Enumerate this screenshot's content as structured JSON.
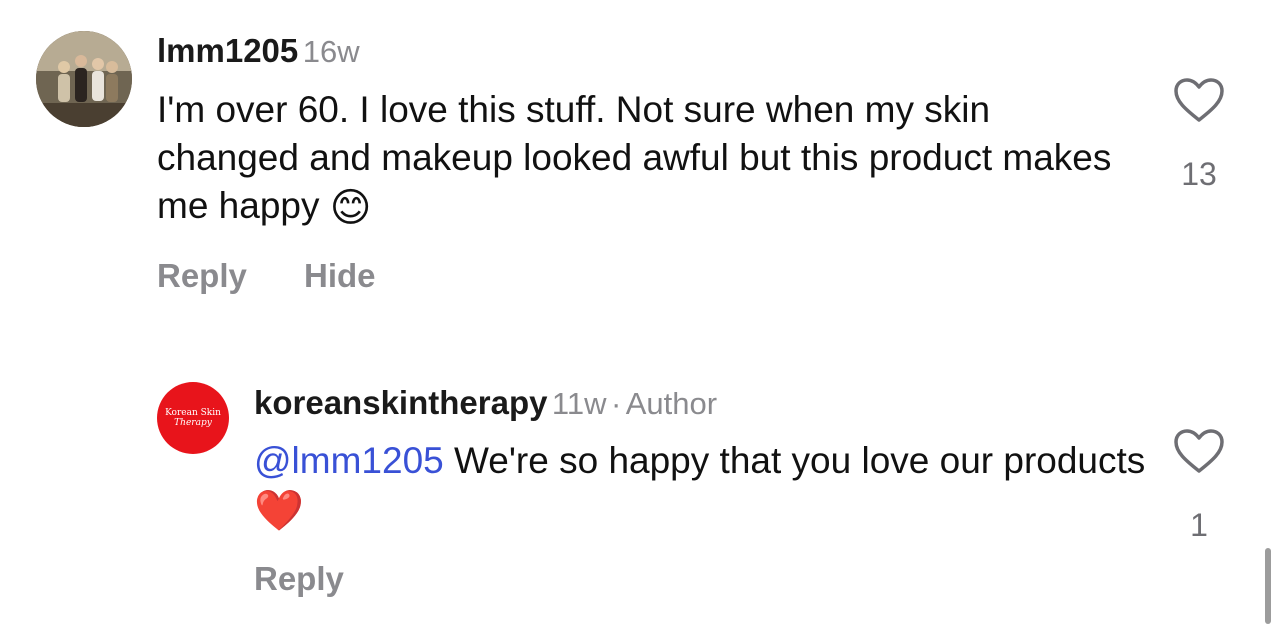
{
  "comments": [
    {
      "username": "lmm1205",
      "age": "16w",
      "text": "I'm over 60.  I love this stuff.  Not sure when my skin changed and makeup looked awful but this product makes me happy",
      "emoji": "😊",
      "like_count": "13",
      "actions": {
        "reply": "Reply",
        "hide": "Hide"
      },
      "avatar_icon": "profile-photo"
    }
  ],
  "reply": {
    "username": "koreanskintherapy",
    "age": "11w",
    "separator": "·",
    "badge": "Author",
    "mention": "@lmm1205",
    "text": "We're so happy that you love our products",
    "emoji": "❤️",
    "like_count": "1",
    "actions": {
      "reply": "Reply"
    },
    "avatar": {
      "line1": "Korean Skin",
      "line2": "Therapy",
      "color": "#e8141b"
    }
  },
  "colors": {
    "secondary_text": "#8a8a8e",
    "mention": "#3951d6"
  }
}
